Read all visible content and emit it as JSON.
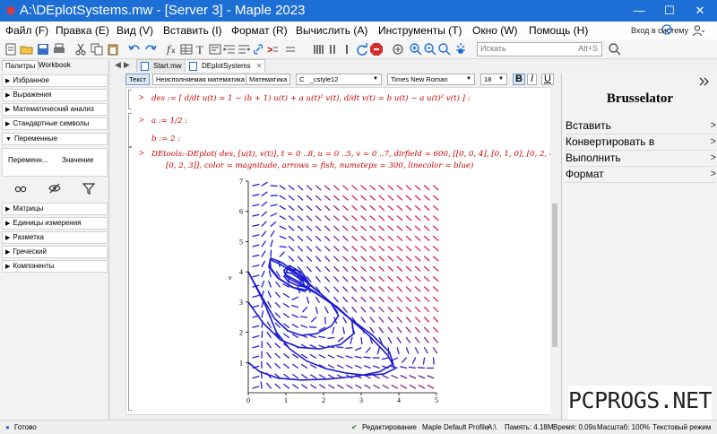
{
  "window": {
    "title": "A:\\DEplotSystems.mw - [Server 3] - Maple 2023",
    "minimize": "—",
    "maximize": "☐",
    "close": "✕"
  },
  "menu": {
    "items": [
      "Файл (F)",
      "Правка (E)",
      "Вид (V)",
      "Вставить (I)",
      "Формат (R)",
      "Вычислить (A)",
      "Инструменты (T)",
      "Окно (W)",
      "Помощь (H)"
    ],
    "login": "Вход в систему"
  },
  "toolbar": {
    "search_placeholder": "Искать",
    "search_shortcut": "Alt+S"
  },
  "palette": {
    "tabs": [
      "Палитры",
      "Workbook"
    ],
    "sections": [
      "Избранное",
      "Выражения",
      "Математический анализ",
      "Стандартные символы",
      "Переменные",
      "Матрицы",
      "Единицы измерения",
      "Разметка",
      "Греческий",
      "Компоненты"
    ],
    "var_columns": [
      "Переменн...",
      "Значение"
    ]
  },
  "doc_tabs": [
    "Start.mw",
    "DEplotSystems"
  ],
  "format_bar": {
    "text_btn": "Текст",
    "nonexec_btn": "Неисполняемая математика",
    "math_btn": "Математика",
    "style": "_cstyle12",
    "font": "Times New Roman",
    "size": "18",
    "style_prefix": "C",
    "bold": "B",
    "italic": "I",
    "underline": "U"
  },
  "worksheet": {
    "line1": "des := [ d/dt u(t) = 1 − (b + 1) u(t) + a u(t)² v(t),  d/dt v(t) = b u(t) − a u(t)² v(t) ] :",
    "line2a": "a := 1/2 :",
    "line2b": "b := 2 :",
    "line3a": "DEtools:-DEplot( des, [u(t), v(t)], t = 0 ..8, u = 0 ..5, v = 0 ..7, dirfield = 600, [[0, 0, 4], [0, 1, 0], [0, 2, 4],",
    "line3b": "[0, 2, 3]], color = magnitude, arrows = fish, numsteps = 300, linecolor = blue)",
    "prompt": ">"
  },
  "chart_data": {
    "type": "line",
    "title": "",
    "xlabel": "u",
    "ylabel": "v",
    "xlim": [
      0,
      5
    ],
    "ylim": [
      0,
      7
    ],
    "x_ticks": [
      "0",
      "1",
      "2",
      "3",
      "4",
      "5"
    ],
    "y_ticks": [
      "1",
      "2",
      "3",
      "4",
      "5",
      "6",
      "7"
    ],
    "series": [
      {
        "color": "#1a1ad0",
        "values": [
          [
            0,
            4
          ],
          [
            0.45,
            2.9
          ],
          [
            0.75,
            2.0
          ],
          [
            1.1,
            1.45
          ],
          [
            1.55,
            1.05
          ],
          [
            2.05,
            0.8
          ],
          [
            2.6,
            0.65
          ],
          [
            3.1,
            0.58
          ],
          [
            3.6,
            0.62
          ],
          [
            3.9,
            0.8
          ],
          [
            3.7,
            1.25
          ],
          [
            3.2,
            1.9
          ],
          [
            2.6,
            2.55
          ],
          [
            1.9,
            3.3
          ],
          [
            1.3,
            3.95
          ],
          [
            0.9,
            4.3
          ],
          [
            0.6,
            4.45
          ],
          [
            0.55,
            4.2
          ],
          [
            0.8,
            3.8
          ],
          [
            1.15,
            3.5
          ],
          [
            1.5,
            3.35
          ],
          [
            1.65,
            3.55
          ],
          [
            1.45,
            3.95
          ],
          [
            1.1,
            4.2
          ],
          [
            0.95,
            4.05
          ],
          [
            1.0,
            3.85
          ]
        ]
      },
      {
        "color": "#1a1ad0",
        "values": [
          [
            0,
            1
          ],
          [
            0.3,
            0.7
          ],
          [
            0.8,
            0.48
          ],
          [
            1.4,
            0.42
          ],
          [
            2.1,
            0.45
          ],
          [
            2.9,
            0.55
          ],
          [
            3.5,
            0.7
          ],
          [
            3.85,
            0.95
          ],
          [
            3.75,
            1.35
          ],
          [
            3.3,
            1.9
          ],
          [
            2.6,
            2.55
          ],
          [
            1.9,
            3.3
          ],
          [
            1.3,
            3.9
          ],
          [
            0.85,
            4.25
          ],
          [
            0.58,
            4.4
          ],
          [
            0.55,
            4.15
          ],
          [
            0.8,
            3.78
          ],
          [
            1.2,
            3.48
          ],
          [
            1.55,
            3.4
          ],
          [
            1.6,
            3.65
          ],
          [
            1.3,
            4.05
          ],
          [
            1.05,
            4.1
          ],
          [
            0.98,
            3.92
          ]
        ]
      },
      {
        "color": "#1a1ad0",
        "values": [
          [
            0,
            4
          ],
          [
            0.35,
            3.2
          ],
          [
            0.7,
            2.45
          ],
          [
            1.05,
            2.05
          ],
          [
            1.4,
            1.9
          ],
          [
            1.8,
            1.95
          ],
          [
            2.2,
            2.2
          ],
          [
            2.4,
            2.55
          ],
          [
            2.2,
            2.95
          ],
          [
            1.75,
            3.35
          ],
          [
            1.3,
            3.7
          ],
          [
            1.0,
            3.9
          ],
          [
            0.95,
            3.85
          ],
          [
            1.05,
            3.7
          ],
          [
            1.3,
            3.55
          ],
          [
            1.5,
            3.5
          ],
          [
            1.45,
            3.7
          ],
          [
            1.15,
            3.95
          ],
          [
            1.0,
            3.98
          ]
        ]
      },
      {
        "color": "#1a1ad0",
        "values": [
          [
            0,
            3
          ],
          [
            0.4,
            2.3
          ],
          [
            0.85,
            1.75
          ],
          [
            1.35,
            1.5
          ],
          [
            1.9,
            1.45
          ],
          [
            2.45,
            1.6
          ],
          [
            2.8,
            1.95
          ],
          [
            2.75,
            2.4
          ],
          [
            2.35,
            2.85
          ],
          [
            1.85,
            3.25
          ],
          [
            1.35,
            3.6
          ],
          [
            1.05,
            3.8
          ],
          [
            0.98,
            3.9
          ]
        ]
      }
    ]
  },
  "context": {
    "title": "Brusselator",
    "items": [
      "Вставить",
      "Конвертировать в",
      "Выполнить",
      "Формат"
    ]
  },
  "watermark": "PCPROGS.NET",
  "status": {
    "ready": "Готово",
    "edit_mode": "Редактирование",
    "profile": "Maple Default Profile",
    "drive": "A:\\",
    "memory": "Память: 4.18M",
    "time": "Время: 0.09s",
    "zoom": "Масштаб: 100%",
    "mode": "Текстовый режим"
  }
}
